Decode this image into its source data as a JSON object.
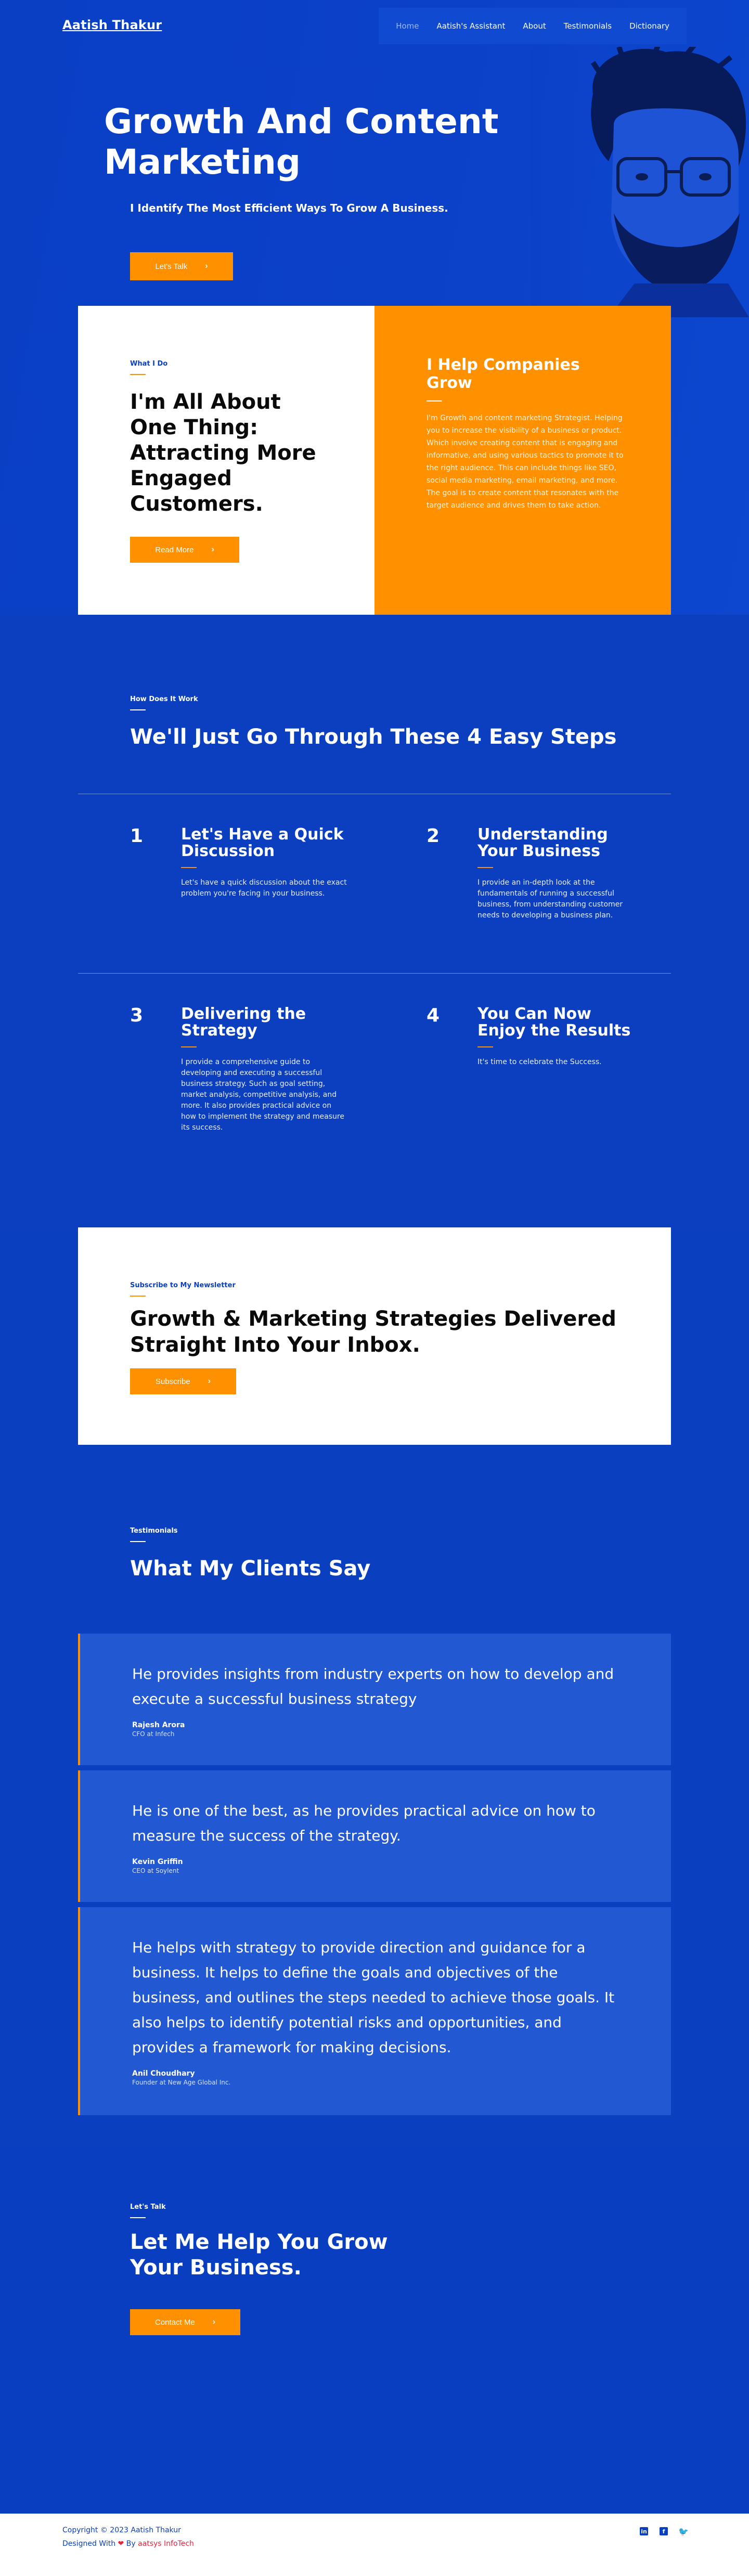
{
  "nav": {
    "brand": "Aatish Thakur",
    "items": [
      {
        "label": "Home"
      },
      {
        "label": "Aatish's Assistant"
      },
      {
        "label": "About"
      },
      {
        "label": "Testimonials"
      },
      {
        "label": "Dictionary"
      }
    ]
  },
  "hero": {
    "title": "Growth And Content Marketing",
    "subtitle": "I Identify The Most Efficient Ways To Grow A Business.",
    "cta": "Let's Talk",
    "cta_icon": "chevron-right-icon"
  },
  "what": {
    "eyebrow": "What I Do",
    "title": "I'm All About One Thing: Attracting More Engaged Customers.",
    "cta": "Read More",
    "right_title": "I Help Companies Grow",
    "right_text": "I'm Growth and content marketing  Strategist. Helping you to increase the visibility of a business or product. Which involve creating content that is engaging and informative, and using various tactics to promote it to the right audience. This can include things like SEO, social media marketing, email marketing, and more. The goal is to create content that resonates with the target audience and drives them to take action."
  },
  "steps": {
    "eyebrow": "How Does It Work",
    "title": "We'll Just Go Through These 4 Easy Steps",
    "items": [
      {
        "num": "1",
        "title": "Let's Have a Quick Discussion",
        "text": "Let's have a quick discussion about the exact problem you're facing in your business."
      },
      {
        "num": "2",
        "title": "Understanding Your Business",
        "text": "I provide an in-depth look at the fundamentals of running a successful business, from understanding customer needs to developing a business plan."
      },
      {
        "num": "3",
        "title": "Delivering the Strategy",
        "text": "I provide a comprehensive guide to developing and executing a successful business strategy. Such as goal setting, market analysis, competitive analysis, and more. It also provides practical advice on how to implement the strategy and measure its success."
      },
      {
        "num": "4",
        "title": "You Can Now Enjoy the Results",
        "text": "It's time to celebrate the Success."
      }
    ]
  },
  "newsletter": {
    "eyebrow": "Subscribe to My Newsletter",
    "title": "Growth & Marketing Strategies Delivered Straight Into Your Inbox.",
    "cta": "Subscribe"
  },
  "testimonials": {
    "eyebrow": "Testimonials",
    "title": "What My Clients Say",
    "items": [
      {
        "quote": "He provides insights from industry experts on how to develop and execute a successful business strategy",
        "name": "Rajesh Arora",
        "role": "CFO at Infech"
      },
      {
        "quote": "He is one of the best, as he provides practical advice on how to measure the success of the strategy.",
        "name": "Kevin Griffin",
        "role": "CEO at Soylent"
      },
      {
        "quote": "He helps with strategy to provide direction and guidance for a business. It helps to define the goals and objectives of the business, and outlines the steps needed to achieve those goals. It also helps to identify potential risks and opportunities, and provides a framework for making decisions.",
        "name": "Anil Choudhary",
        "role": "Founder at New Age Global Inc."
      }
    ]
  },
  "talk": {
    "eyebrow": "Let's Talk",
    "title": "Let Me Help You Grow Your Business.",
    "cta": "Contact Me"
  },
  "footer": {
    "copyright": "Copyright © 2023 Aatish Thakur",
    "designed_prefix": "Designed With",
    "designed_by": "By",
    "designer": "aatsys InfoTech",
    "socials": [
      "linkedin-icon",
      "facebook-icon",
      "twitter-icon"
    ]
  },
  "colors": {
    "primary_blue": "#0a3fc0",
    "accent_orange": "#ff9000",
    "card_blue": "#2358d3",
    "white": "#ffffff"
  }
}
